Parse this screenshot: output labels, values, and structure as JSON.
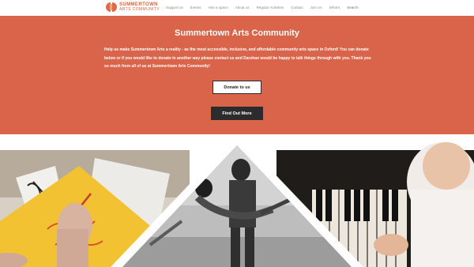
{
  "header": {
    "logo": {
      "line1": "SUMMERTOWN",
      "line2": "ARTS COMMUNITY"
    },
    "nav": [
      {
        "label": "Support us"
      },
      {
        "label": "Events"
      },
      {
        "label": "Hire a space"
      },
      {
        "label": "About us"
      },
      {
        "label": "Regular Activities"
      },
      {
        "label": "Contact"
      },
      {
        "label": "Join Us"
      },
      {
        "label": "What's"
      },
      {
        "label": "Search"
      }
    ]
  },
  "hero": {
    "title": "Summertown Arts Community",
    "text": "Help us make Summertown Arts a reality - as the most accessible, inclusive, and affordable community arts space in Oxford! You can donate below or if you would like to donate in another way please contact us and Darshan would be happy to talk things through with you. Thank you so much from all of us at Summertown Arts Community!",
    "donate_label": "Donate to us",
    "more_label": "Find Out More"
  },
  "colors": {
    "hero_bg": "#d9644a",
    "brand": "#d8603b",
    "dark_button": "#2c2c2c"
  },
  "photos": {
    "left": "painting-hand",
    "center": "ballet-dancers",
    "right": "child-piano"
  }
}
